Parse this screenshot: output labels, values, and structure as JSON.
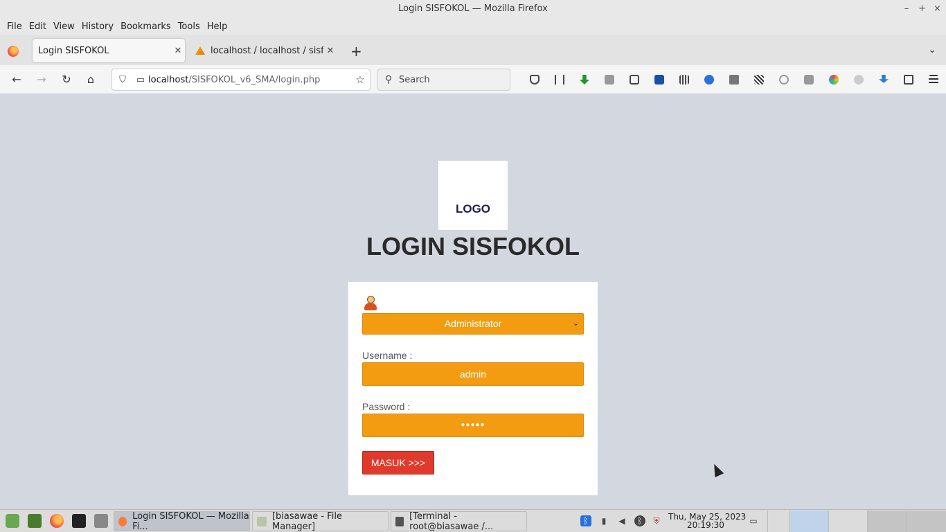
{
  "window": {
    "title": "Login SISFOKOL — Mozilla Firefox"
  },
  "menubar": {
    "items": [
      "File",
      "Edit",
      "View",
      "History",
      "Bookmarks",
      "Tools",
      "Help"
    ]
  },
  "tabs": [
    {
      "label": "Login SISFOKOL",
      "active": true
    },
    {
      "label": "localhost / localhost / sisfokol",
      "active": false
    }
  ],
  "navbar": {
    "url_host": "localhost",
    "url_path": "/SISFOKOL_v6_SMA/login.php",
    "search_placeholder": "Search"
  },
  "page": {
    "logo_text": "LOGO",
    "title": "LOGIN SISFOKOL",
    "role_selected": "Administrator",
    "username_label": "Username :",
    "username_value": "admin",
    "password_label": "Password :",
    "password_value": "●●●●●",
    "submit_label": "MASUK >>>"
  },
  "colors": {
    "accent": "#f39c12",
    "submit": "#e03a2c",
    "page_bg": "#d3d7df"
  },
  "taskbar": {
    "tasks": [
      {
        "label": "Login SISFOKOL — Mozilla Fi...",
        "active": true
      },
      {
        "label": "[biasawae - File Manager]",
        "active": false
      },
      {
        "label": "[Terminal - root@biasawae /...",
        "active": false
      }
    ],
    "clock_date": "Thu, May 25, 2023",
    "clock_time": "20:19:30"
  }
}
